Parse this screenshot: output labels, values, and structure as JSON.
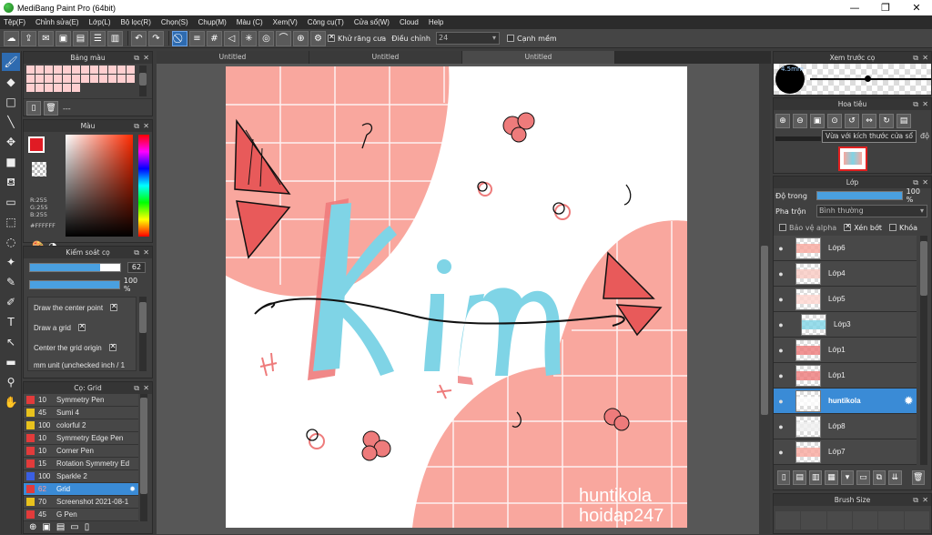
{
  "app": {
    "title": "MediBang Paint Pro (64bit)"
  },
  "menu": [
    "Tệp(F)",
    "Chỉnh sửa(E)",
    "Lớp(L)",
    "Bộ lọc(R)",
    "Chọn(S)",
    "Chụp(M)",
    "Màu (C)",
    "Xem(V)",
    "Công cụ(T)",
    "Cửa sổ(W)",
    "Cloud",
    "Help"
  ],
  "toolbar": {
    "antialias_label": "Khử răng cưa",
    "correction_label": "Điều chỉnh",
    "correction_value": "24",
    "smooth_label": "Cạnh mềm"
  },
  "panels": {
    "palette_title": "Bảng màu",
    "palette_placeholder": "---",
    "color_title": "Màu",
    "rgb": {
      "r": "R:255",
      "g": "G:255",
      "b": "B:255",
      "hex": "#FFFFFF"
    },
    "brush_control_title": "Kiểm soát cọ",
    "brush_size_value": "62",
    "brush_opacity_value": "100 %",
    "options": [
      {
        "label": "Draw the center point",
        "checked": true
      },
      {
        "label": "Draw a grid",
        "checked": true
      },
      {
        "label": "Center the grid origin",
        "checked": true
      },
      {
        "label": "mm unit (unchecked inch / 1",
        "checked": false
      }
    ],
    "brush_list_title": "Cọ: Grid",
    "brushes": [
      {
        "size": "10",
        "name": "Symmetry Pen",
        "color": "#e23b3b",
        "selected": false
      },
      {
        "size": "45",
        "name": "Sumi 4",
        "color": "#e8c21d",
        "selected": false
      },
      {
        "size": "100",
        "name": "colorful 2",
        "color": "#e8c21d",
        "selected": false
      },
      {
        "size": "10",
        "name": "Symmetry Edge Pen",
        "color": "#e23b3b",
        "selected": false
      },
      {
        "size": "10",
        "name": "Corner Pen",
        "color": "#e23b3b",
        "selected": false
      },
      {
        "size": "15",
        "name": "Rotation Symmetry Ed",
        "color": "#e23b3b",
        "selected": false
      },
      {
        "size": "100",
        "name": "Sparkle 2",
        "color": "#3b5fe2",
        "selected": false
      },
      {
        "size": "62",
        "name": "Grid",
        "color": "#e23b3b",
        "selected": true
      },
      {
        "size": "70",
        "name": "Screenshot 2021-08-1",
        "color": "#e8c21d",
        "selected": false
      },
      {
        "size": "45",
        "name": "G Pen",
        "color": "#e23b3b",
        "selected": false
      }
    ]
  },
  "tabs": [
    "Untitled",
    "Untitled",
    "Untitled"
  ],
  "canvas": {
    "title_text": "Kim",
    "watermark_line1": "huntikola",
    "watermark_line2": "hoidap247"
  },
  "right": {
    "preview_title": "Xem trước cọ",
    "preview_size": "4.5mm",
    "navigator_title": "Hoa tiêu",
    "tooltip": "Vừa với kích thước cửa sổ",
    "navigator_partial": "độ",
    "layer_title": "Lớp",
    "opacity_label": "Độ trong",
    "opacity_value": "100 %",
    "blend_label": "Pha trộn",
    "blend_value": "Bình thường",
    "protect_alpha": "Bảo vệ alpha",
    "clipping": "Xén bớt",
    "lock": "Khóa",
    "layers": [
      {
        "name": "Lớp6",
        "selected": false
      },
      {
        "name": "Lớp4",
        "selected": false
      },
      {
        "name": "Lớp5",
        "selected": false
      },
      {
        "name": "Lớp3",
        "selected": false
      },
      {
        "name": "Lớp1",
        "selected": false
      },
      {
        "name": "Lớp1",
        "selected": false
      },
      {
        "name": "huntikola",
        "selected": true
      },
      {
        "name": "Lớp8",
        "selected": false
      },
      {
        "name": "Lớp7",
        "selected": false
      }
    ],
    "brush_size_title": "Brush Size"
  },
  "colors": {
    "accent": "#3a8bd6",
    "pink": "#f9a79e",
    "cyan": "#7fd4e6"
  }
}
